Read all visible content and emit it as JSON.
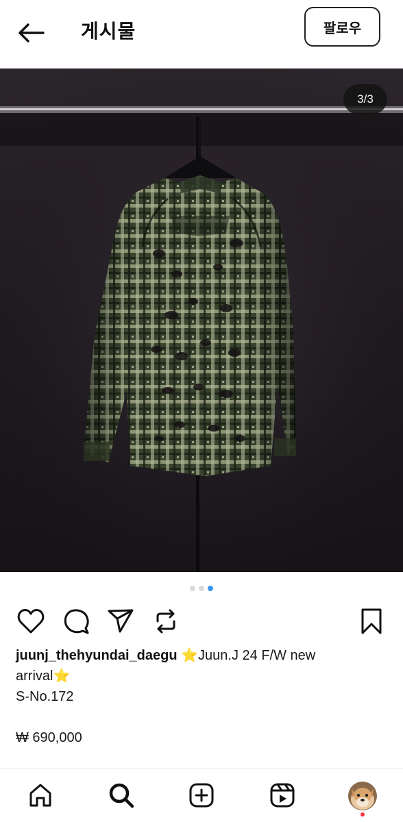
{
  "header": {
    "title": "게시물",
    "follow_label": "팔로우",
    "back_icon": "arrow-left-icon"
  },
  "post": {
    "image_counter": "3/3",
    "image_description": "plaid green shirt jacket hanging on rack",
    "carousel": {
      "total": 3,
      "active": 3
    }
  },
  "actions": {
    "icons": [
      "heart-icon",
      "comment-icon",
      "share-icon",
      "repost-icon",
      "bookmark-icon"
    ]
  },
  "caption": {
    "username": "juunj_thehyundai_daegu",
    "text_line1": "⭐Juun.J 24 F/W new",
    "text_line2": "arrival⭐",
    "sku": "S-No.172",
    "price": "₩ 690,000"
  },
  "bottom_nav": {
    "items": [
      "home-icon",
      "search-icon",
      "create-icon",
      "reels-icon",
      "profile-avatar"
    ],
    "has_notification": true
  },
  "colors": {
    "accent": "#3897f0",
    "notification": "#ff3040",
    "text": "#111111"
  }
}
